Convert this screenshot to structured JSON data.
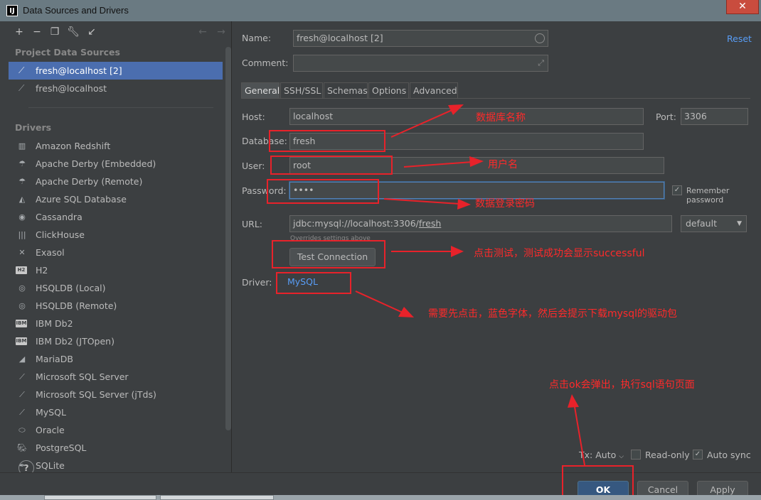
{
  "window": {
    "title": "Data Sources and Drivers",
    "app_icon": "IJ",
    "close": "✕"
  },
  "left": {
    "toolbar_icons": [
      "add-icon",
      "remove-icon",
      "copy-icon",
      "wrench-icon",
      "import-icon",
      "back-arrow-icon",
      "forward-arrow-icon"
    ],
    "project_title": "Project Data Sources",
    "data_sources": [
      {
        "label": "fresh@localhost [2]",
        "selected": true
      },
      {
        "label": "fresh@localhost",
        "selected": false
      }
    ],
    "drivers_title": "Drivers",
    "drivers": [
      "Amazon Redshift",
      "Apache Derby (Embedded)",
      "Apache Derby (Remote)",
      "Azure SQL Database",
      "Cassandra",
      "ClickHouse",
      "Exasol",
      "H2",
      "HSQLDB (Local)",
      "HSQLDB (Remote)",
      "IBM Db2",
      "IBM Db2 (JTOpen)",
      "MariaDB",
      "Microsoft SQL Server",
      "Microsoft SQL Server (jTds)",
      "MySQL",
      "Oracle",
      "PostgreSQL",
      "SQLite"
    ],
    "badges": {
      "h2": "H2",
      "ibm": "IBM DB2"
    },
    "help": "?"
  },
  "form": {
    "name_label": "Name:",
    "name_value": "fresh@localhost [2]",
    "reset": "Reset",
    "comment_label": "Comment:",
    "comment_value": "",
    "tabs": [
      "General",
      "SSH/SSL",
      "Schemas",
      "Options",
      "Advanced"
    ],
    "host_label": "Host:",
    "host_value": "localhost",
    "port_label": "Port:",
    "port_value": "3306",
    "database_label": "Database:",
    "database_value": "fresh",
    "user_label": "User:",
    "user_value": "root",
    "password_label": "Password:",
    "password_value": "••••",
    "remember_password": "Remember password",
    "url_label": "URL:",
    "url_prefix": "jdbc:mysql://localhost:3306/",
    "url_db": "fresh",
    "url_note": "Overrides settings above",
    "url_mode": "default",
    "test_connection": "Test Connection",
    "driver_label": "Driver:",
    "driver_value": "MySQL",
    "tx_label": "Tx: Auto",
    "read_only": "Read-only",
    "auto_sync": "Auto sync",
    "ok": "OK",
    "cancel": "Cancel",
    "apply": "Apply"
  },
  "annotations": {
    "db_name": "数据库名称",
    "username": "用户名",
    "password": "数据登录密码",
    "test": "点击测试，测试成功会显示successful",
    "driver": "需要先点击，蓝色字体，然后会提示下载mysql的驱动包",
    "ok": "点击ok会弹出，执行sql语句页面"
  },
  "colors": {
    "annotation": "#e8222a",
    "selection": "#4b6eaf",
    "link": "#589df6",
    "primary_button": "#365880"
  }
}
